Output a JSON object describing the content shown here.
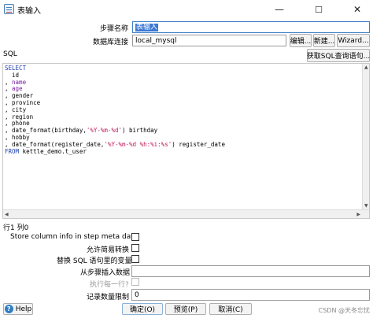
{
  "window": {
    "title": "表输入",
    "controls": {
      "minimize": "—",
      "maximize": "☐",
      "close": "✕"
    }
  },
  "form": {
    "step_name_label": "步骤名称",
    "step_name_value": "表输入",
    "db_conn_label": "数据库连接",
    "db_conn_value": "local_mysql",
    "edit_btn": "编辑...",
    "new_btn": "新建...",
    "wizard_btn": "Wizard...",
    "sql_label": "SQL",
    "get_sql_btn": "获取SQL查询语句..."
  },
  "sql": {
    "lines": [
      [
        {
          "t": "SELECT",
          "c": "kw"
        }
      ],
      [
        {
          "t": "  id",
          "c": "txt"
        }
      ],
      [
        {
          "t": ", ",
          "c": "txt"
        },
        {
          "t": "name",
          "c": "fld"
        }
      ],
      [
        {
          "t": ", ",
          "c": "txt"
        },
        {
          "t": "age",
          "c": "fld"
        }
      ],
      [
        {
          "t": ", gender",
          "c": "txt"
        }
      ],
      [
        {
          "t": ", province",
          "c": "txt"
        }
      ],
      [
        {
          "t": ", city",
          "c": "txt"
        }
      ],
      [
        {
          "t": ", region",
          "c": "txt"
        }
      ],
      [
        {
          "t": ", phone",
          "c": "txt"
        }
      ],
      [
        {
          "t": ", date_format(birthday,",
          "c": "txt"
        },
        {
          "t": "'%Y-%m-%d'",
          "c": "str"
        },
        {
          "t": ") birthday",
          "c": "txt"
        }
      ],
      [
        {
          "t": ", hobby",
          "c": "txt"
        }
      ],
      [
        {
          "t": ", date_format(register_date,",
          "c": "txt"
        },
        {
          "t": "'%Y-%m-%d %h:%i:%s'",
          "c": "str"
        },
        {
          "t": ") register_date",
          "c": "txt"
        }
      ],
      [
        {
          "t": "FROM ",
          "c": "kw"
        },
        {
          "t": "kettle_demo.t_user",
          "c": "txt"
        }
      ]
    ],
    "cursor_position": "行1 列0"
  },
  "options": {
    "store_column_info_label": "Store column info in step meta data",
    "lazy_conversion_label": "允许简易转换",
    "replace_variables_label": "替换 SQL 语句里的变量",
    "insert_from_step_label": "从步骤插入数据",
    "insert_from_step_value": "",
    "execute_each_row_label": "执行每一行?",
    "record_limit_label": "记录数量限制",
    "record_limit_value": "0"
  },
  "footer": {
    "help_btn": "Help",
    "ok_btn": "确定(O)",
    "preview_btn": "预览(P)",
    "cancel_btn": "取消(C)"
  },
  "watermark": "CSDN @天冬忘忧"
}
